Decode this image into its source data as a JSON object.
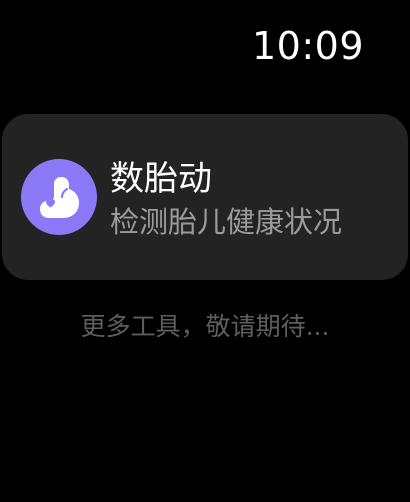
{
  "status_bar": {
    "time": "10:09"
  },
  "tool_card": {
    "icon": "fetal-movement-icon",
    "title": "数胎动",
    "subtitle": "检测胎儿健康状况"
  },
  "footer": {
    "more_hint": "更多工具，敬请期待..."
  },
  "colors": {
    "background": "#000000",
    "card": "#232323",
    "accent": "#8c79f7",
    "subtitle": "#9b9b9b",
    "hint": "#5e5e5e"
  }
}
